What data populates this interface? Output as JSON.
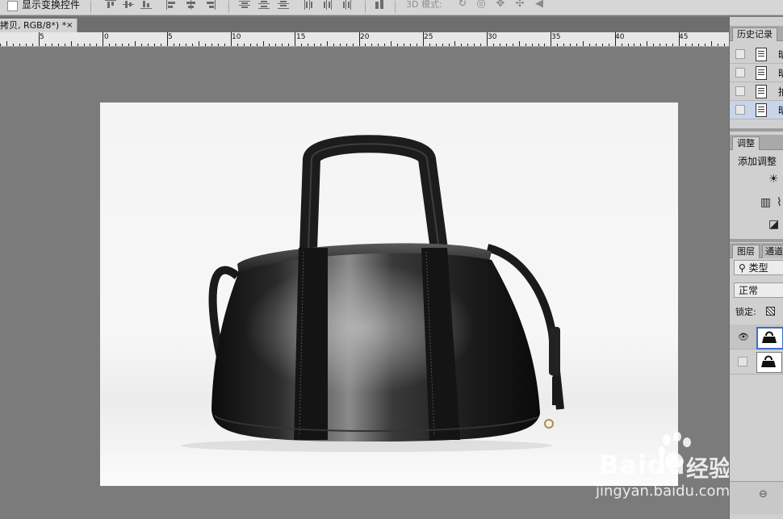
{
  "options_bar": {
    "show_transform_controls_label": "显示变换控件",
    "mode_3d_label": "3D 模式:",
    "align_icons": [
      "align-top-edges-icon",
      "align-vertical-centers-icon",
      "align-bottom-edges-icon",
      "align-left-edges-icon",
      "align-horizontal-centers-icon",
      "align-right-edges-icon",
      "distribute-top-edges-icon",
      "distribute-vertical-centers-icon",
      "distribute-bottom-edges-icon",
      "distribute-left-edges-icon",
      "distribute-horizontal-centers-icon",
      "distribute-right-edges-icon",
      "auto-align-layers-icon"
    ],
    "mode3d_icons": [
      "rotate-3d-icon",
      "roll-3d-icon",
      "drag-3d-icon",
      "slide-3d-icon",
      "scale-3d-icon"
    ]
  },
  "document": {
    "tab_title": "拷贝, RGB/8*) *",
    "tab_close": "×"
  },
  "ruler": {
    "labels": [
      "5",
      "0",
      "5",
      "10",
      "15",
      "20",
      "25",
      "30",
      "35",
      "40",
      "45"
    ]
  },
  "canvas": {
    "subject": "black-leather-handbag"
  },
  "watermark": {
    "brand": "Bai",
    "brand_suffix": "du",
    "brand_cn": "经验",
    "url": "jingyan.baidu.com"
  },
  "history_panel": {
    "tab_label": "历史记录",
    "items": [
      {
        "text": "昕",
        "selected": false
      },
      {
        "text": "昕",
        "selected": false
      },
      {
        "text": "拍",
        "selected": false
      },
      {
        "text": "昕",
        "selected": true
      }
    ]
  },
  "adjustments_panel": {
    "tab_label": "调整",
    "title": "添加调整",
    "icons": [
      "brightness-contrast-icon",
      "levels-icon",
      "curves-icon",
      "exposure-icon"
    ]
  },
  "layers_panel": {
    "tab_label": "图层",
    "tab2_label": "通道",
    "filter_label": "类型",
    "blend_mode": "正常",
    "lock_label": "锁定:",
    "layers": [
      {
        "visible": true,
        "selected": true
      },
      {
        "visible": false,
        "selected": false
      }
    ]
  }
}
